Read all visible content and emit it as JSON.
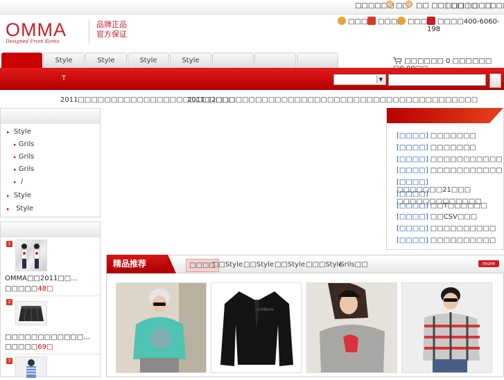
{
  "topbar": {
    "welcome": "□□□□□□",
    "links": [
      "□□",
      "□□ □□□□□",
      "□□□□",
      "□□□",
      "□□□"
    ]
  },
  "logo": {
    "brand": "OMMA",
    "tagline": "Designed From Korea"
  },
  "slogan": [
    "品牌正品",
    "官方保证"
  ],
  "services": [
    {
      "label": "□□□□",
      "icon": "face-icon",
      "color": "#e8a23a"
    },
    {
      "label": "□□□□",
      "icon": "shield-icon",
      "color": "#d83a2a"
    },
    {
      "label": "□□□□",
      "icon": "smile-icon",
      "color": "#e8a23a"
    },
    {
      "label": "□□□□400-6060-198",
      "icon": "phone-icon",
      "color": "#c81d25"
    }
  ],
  "nav": {
    "tabs": [
      "",
      "Style",
      "Style",
      "Style",
      "Style",
      "",
      "",
      ""
    ],
    "active_index": 0
  },
  "cart": {
    "text": "□□□□□□ 0 □□□□□□ □0.00□□",
    "icon": "cart-icon"
  },
  "redbar": {
    "label": "T"
  },
  "search": {
    "category_value": "",
    "placeholder": ""
  },
  "announcements": [
    "2011□□□□□□□□□□□□□□□□□□□□□□□□",
    "2011□2□□□□□□□□□□□□□□□□□□□□□□□□□□□□□□□□□□□□□□□□"
  ],
  "categories": [
    {
      "label": "Style",
      "level": 0
    },
    {
      "label": "Grils",
      "level": 1
    },
    {
      "label": "Grils",
      "level": 1
    },
    {
      "label": "Grils",
      "level": 1
    },
    {
      "label": "/",
      "level": 1
    },
    {
      "label": "Style",
      "level": 0
    },
    {
      "label": "Style",
      "level": 0
    }
  ],
  "hot_products": [
    {
      "rank": "1",
      "name": "OMMA□□2011□□...",
      "price_label": "□□□□□",
      "price": "48□"
    },
    {
      "rank": "2",
      "name": "□□□□□□□□□□□□...",
      "price_label": "□□□□□",
      "price": "69□"
    },
    {
      "rank": "3",
      "name": "",
      "price_label": "",
      "price": ""
    }
  ],
  "news": [
    {
      "tag": "[□□□□]",
      "text": "□□□□□□□"
    },
    {
      "tag": "[□□□□]",
      "text": "□□□□□□□"
    },
    {
      "tag": "[□□□□]",
      "text": "□□□□□□□□□□□"
    },
    {
      "tag": "[□□□□]",
      "text": "□□□□□□□□□□□"
    },
    {
      "tag": "[□□□□]",
      "text": "□□□□□□□21□□□"
    },
    {
      "tag": "[□□□□]",
      "text": "□□□□□□□□□□□□□"
    },
    {
      "tag": "[□□□□]",
      "text": "□□T□□□□□□"
    },
    {
      "tag": "[□□□□]",
      "text": "□□CSV□□□"
    },
    {
      "tag": "[□□□□]",
      "text": "□□□□□□□□□□"
    },
    {
      "tag": "[□□□□]",
      "text": "□□□□□□□□□□"
    }
  ],
  "featured": {
    "title": "精品推荐",
    "tabs": [
      "□□□□",
      "□□Style",
      "□□Style",
      "□□Style",
      "□□□Style",
      "Grils□□"
    ],
    "active_index": 0,
    "more_label": "more"
  },
  "colors": {
    "brand_red": "#c81d25",
    "nav_red": "#cc0000",
    "link_blue": "#1a4db3"
  }
}
